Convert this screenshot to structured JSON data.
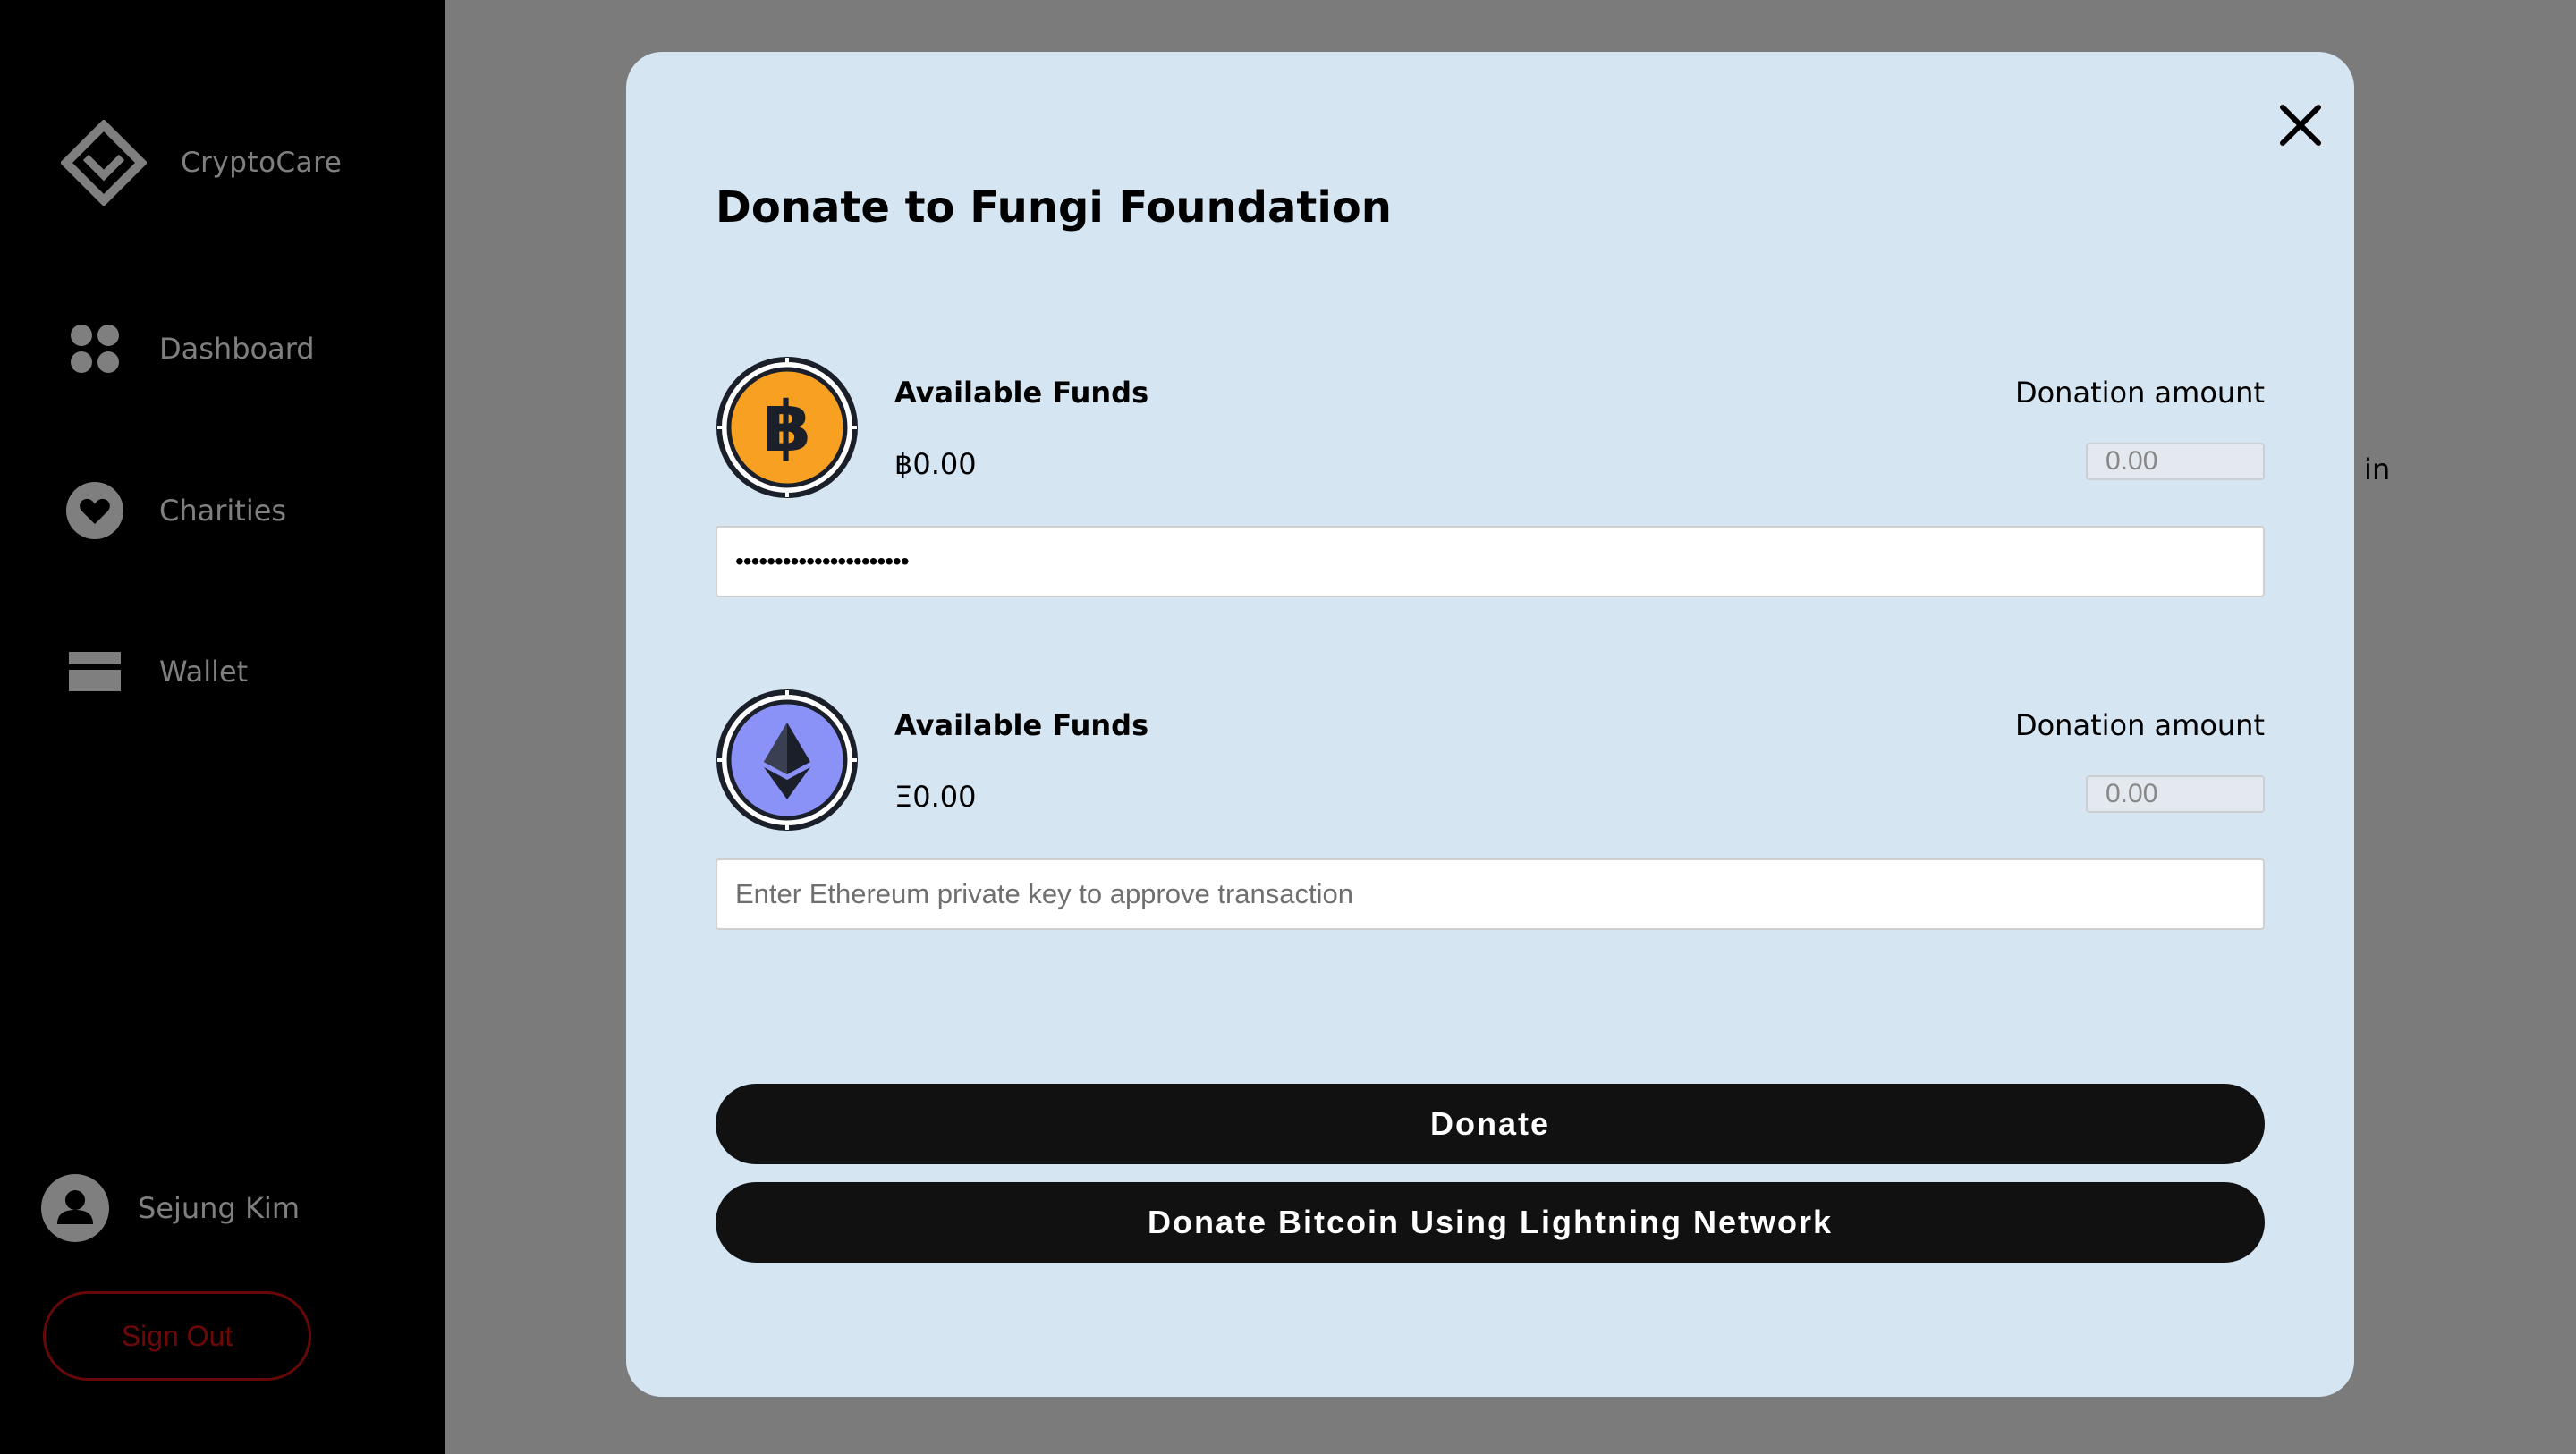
{
  "sidebar": {
    "brand_name": "CryptoCare",
    "nav": [
      {
        "label": "Dashboard",
        "icon": "dashboard-grid-icon"
      },
      {
        "label": "Charities",
        "icon": "heart-icon"
      },
      {
        "label": "Wallet",
        "icon": "wallet-card-icon"
      }
    ],
    "user_name": "Sejung Kim",
    "sign_out_label": "Sign Out"
  },
  "background": {
    "partial_text": "ched in"
  },
  "modal": {
    "title": "Donate to Fungi Foundation",
    "bitcoin": {
      "icon": "bitcoin-icon",
      "funds_label": "Available Funds",
      "funds_value": "C0.00",
      "amount_label": "Donation amount",
      "amount_placeholder": "0.00",
      "key_value_masked": "••••••••••••••••••••••"
    },
    "ethereum": {
      "icon": "ethereum-icon",
      "funds_label": "Available Funds",
      "funds_value": "Ξ0.00",
      "amount_label": "Donation amount",
      "amount_placeholder": "0.00",
      "key_placeholder": "Enter Ethereum private key to approve transaction"
    },
    "donate_label": "Donate",
    "lightning_label": "Donate Bitcoin Using Lightning Network"
  },
  "colors": {
    "sidebar_bg": "#000000",
    "modal_bg": "#d5e5f2",
    "bitcoin_orange": "#f7a021",
    "ethereum_purple": "#8a92f7",
    "button_bg": "#111111",
    "sign_out_red": "#cc1111"
  }
}
